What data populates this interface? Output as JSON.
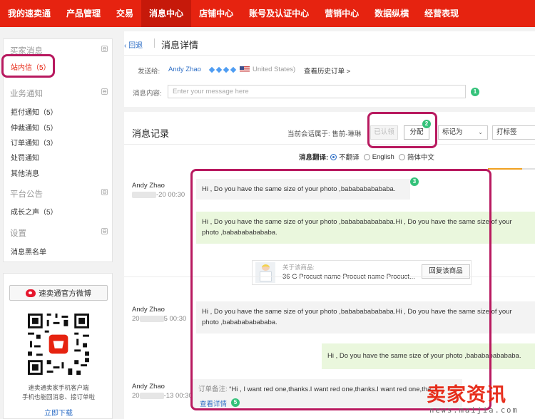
{
  "topnav": {
    "items": [
      "我的速卖通",
      "产品管理",
      "交易",
      "消息中心",
      "店铺中心",
      "账号及认证中心",
      "营销中心",
      "数据纵横",
      "经营表现"
    ],
    "active_index": 3,
    "brand_color": "#e62310"
  },
  "sidebar": {
    "groups": [
      {
        "title": "买家消息",
        "items": [
          "站内信（5）"
        ]
      },
      {
        "title": "业务通知",
        "items": [
          "拒付通知（5）",
          "仲裁通知（5）",
          "订单通知（3）",
          "处罚通知",
          "其他消息"
        ]
      },
      {
        "title": "平台公告",
        "items": [
          "成长之声（5）"
        ]
      },
      {
        "title": "设置",
        "items": [
          "消息黑名单"
        ]
      }
    ],
    "collapse_symbol": "⊖",
    "active_item": "站内信（5）"
  },
  "qr_panel": {
    "weibo_button": "速卖通官方微博",
    "caption_line1": "速卖通卖家手机客户端",
    "caption_line2": "手机也能回消息、接订单啦",
    "download_link": "立即下载"
  },
  "detail": {
    "back": "‹ 回退",
    "title": "消息详情",
    "send_to_label": "发送给:",
    "buyer_name": "Andy Zhao",
    "country": "United States)",
    "history_link": "查看历史订单 >",
    "content_label": "消息内容:",
    "content_placeholder": "Enter your message here",
    "badge1": "1"
  },
  "records": {
    "title": "消息记录",
    "conversation_owner": "当前会话属于: 售前-琳琳",
    "btn_confirmed": "已认领",
    "btn_assign": "分配",
    "badge2": "2",
    "mark_select": "标记为",
    "tag_select": "打标签",
    "translate_label": "消息翻译:",
    "translate_options": [
      "不翻译",
      "English",
      "简体中文"
    ],
    "translate_selected": "不翻译",
    "scroll_progress": 0.72,
    "badge3": "3",
    "badge5": "5",
    "messages": [
      {
        "sender": "Andy Zhao",
        "time": "-20 00:30",
        "text": "Hi , Do you have the same size of your photo ,bababababababa."
      },
      {
        "text": "Hi , Do you have the same size of your photo ,bababababababa.Hi , Do you have the same size of your photo ,bababababababa."
      },
      {
        "sender": "Andy Zhao",
        "time_prefix": "20",
        "time": "5 00:30",
        "text": "Hi , Do you have the same size of your photo ,bababababababa.Hi , Do you have the same size of your photo ,bababababababa."
      },
      {
        "text": "Hi , Do you have the same size of your photo ,bababababababa."
      },
      {
        "sender": "Andy Zhao",
        "time_prefix": "20",
        "time": "-13 00:30"
      }
    ],
    "product": {
      "about": "关于该商品:",
      "name": "36 G Procuct name Procuct name Procuct...",
      "reply_button": "回复该商品"
    },
    "order_note_label": "订单备注:",
    "order_note_text": "“Hi , I want red one,thanks.I want red one,thanks.I want red one,tha",
    "view_detail": "查看详情"
  },
  "watermark": {
    "zh": "卖家资讯",
    "en": "news.maijia.com"
  },
  "colors": {
    "accent": "#e62310",
    "link": "#2f6fc6",
    "highlight_ring": "#b8195f",
    "badge": "#34c27a",
    "outgoing_bubble": "#eaf7dd"
  }
}
